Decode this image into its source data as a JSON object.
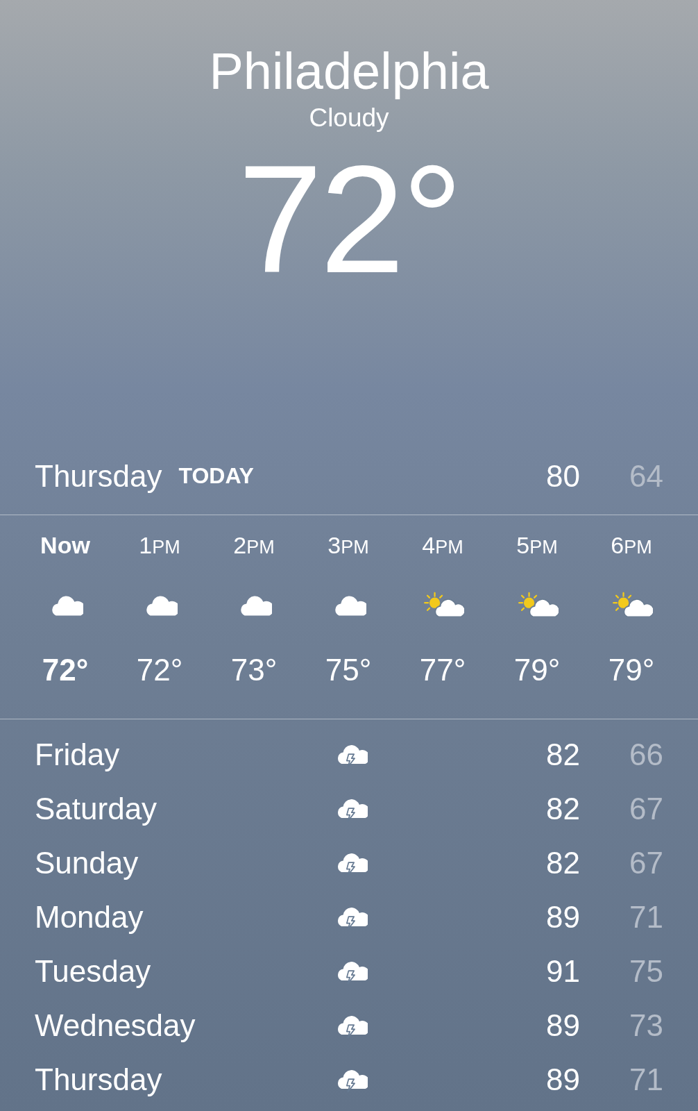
{
  "location": {
    "city": "Philadelphia",
    "condition": "Cloudy",
    "temperature": "72°"
  },
  "today": {
    "day": "Thursday",
    "label": "TODAY",
    "high": "80",
    "low": "64"
  },
  "hourly": [
    {
      "hour": "Now",
      "current": true,
      "kind": "cloudy",
      "temp": "72°"
    },
    {
      "hour": "1",
      "suffix": "PM",
      "current": false,
      "kind": "cloudy",
      "temp": "72°"
    },
    {
      "hour": "2",
      "suffix": "PM",
      "current": false,
      "kind": "cloudy",
      "temp": "73°"
    },
    {
      "hour": "3",
      "suffix": "PM",
      "current": false,
      "kind": "cloudy",
      "temp": "75°"
    },
    {
      "hour": "4",
      "suffix": "PM",
      "current": false,
      "kind": "partly-sunny",
      "temp": "77°"
    },
    {
      "hour": "5",
      "suffix": "PM",
      "current": false,
      "kind": "partly-sunny",
      "temp": "79°"
    },
    {
      "hour": "6",
      "suffix": "PM",
      "current": false,
      "kind": "partly-sunny",
      "temp": "79°"
    }
  ],
  "daily": [
    {
      "day": "Friday",
      "kind": "thunderstorm",
      "high": "82",
      "low": "66"
    },
    {
      "day": "Saturday",
      "kind": "thunderstorm",
      "high": "82",
      "low": "67"
    },
    {
      "day": "Sunday",
      "kind": "thunderstorm",
      "high": "82",
      "low": "67"
    },
    {
      "day": "Monday",
      "kind": "thunderstorm",
      "high": "89",
      "low": "71"
    },
    {
      "day": "Tuesday",
      "kind": "thunderstorm",
      "high": "91",
      "low": "75"
    },
    {
      "day": "Wednesday",
      "kind": "thunderstorm",
      "high": "89",
      "low": "73"
    },
    {
      "day": "Thursday",
      "kind": "thunderstorm",
      "high": "89",
      "low": "71"
    }
  ]
}
